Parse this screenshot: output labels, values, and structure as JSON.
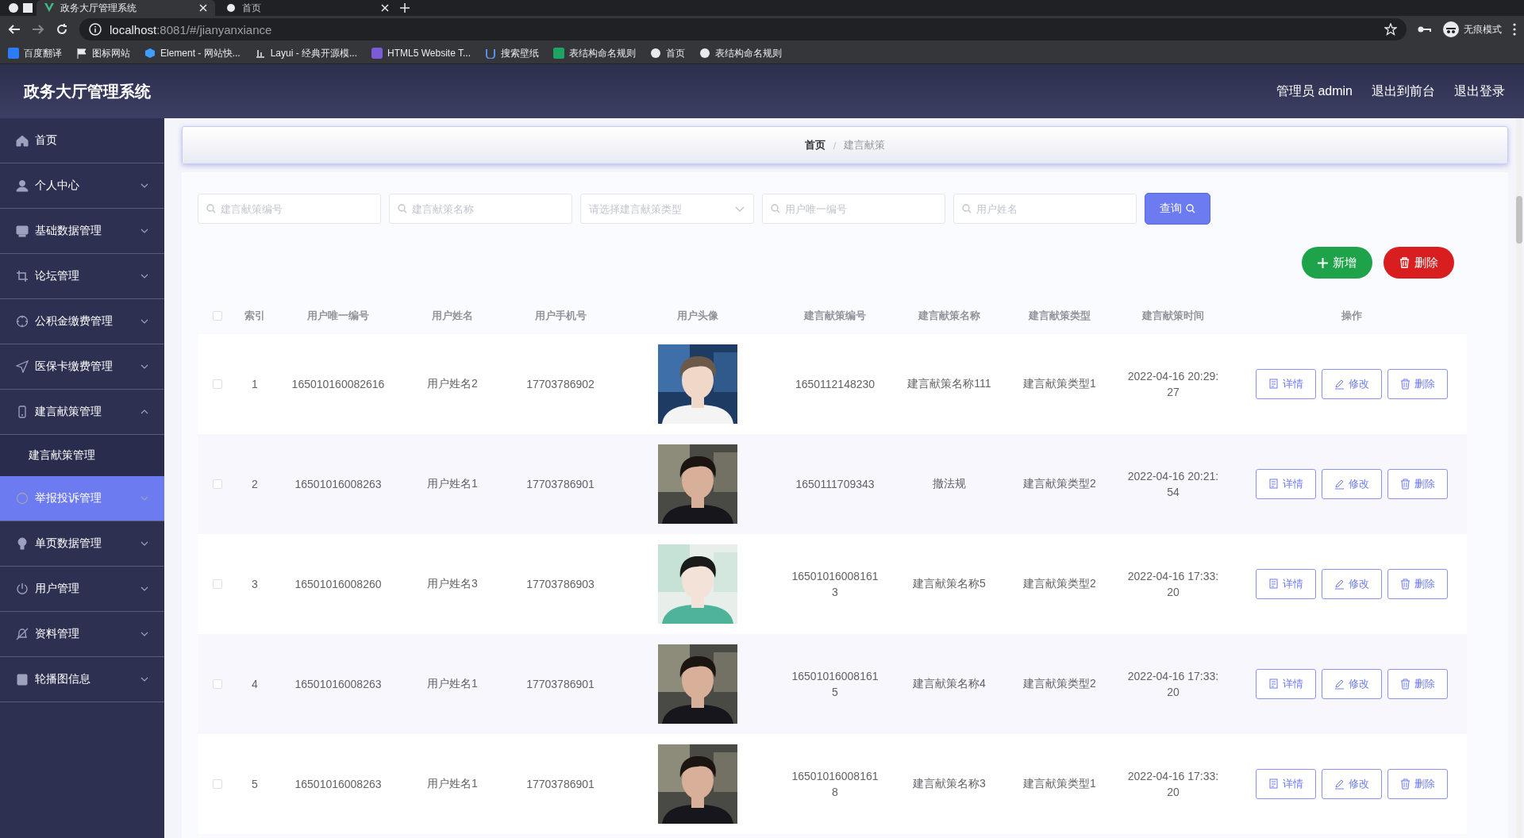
{
  "browser": {
    "tabs": [
      {
        "title": "政务大厅管理系统",
        "selected": true
      },
      {
        "title": "首页",
        "selected": false
      }
    ],
    "url": {
      "host": "localhost",
      "path": ":8081/#/jianyanxiance"
    },
    "profile": "无痕模式",
    "bookmarks": [
      "百度翻译",
      "图标网站",
      "Element - 网站快...",
      "Layui - 经典开源模...",
      "HTML5 Website T...",
      "搜索壁纸",
      "表结构命名规则",
      "首页",
      "表结构命名规则"
    ]
  },
  "header": {
    "title": "政务大厅管理系统",
    "links": [
      "管理员 admin",
      "退出到前台",
      "退出登录"
    ]
  },
  "sidebar": {
    "items": [
      {
        "label": "首页",
        "expandable": false,
        "expanded": false,
        "selected": false
      },
      {
        "label": "个人中心",
        "expandable": true,
        "expanded": false,
        "selected": false
      },
      {
        "label": "基础数据管理",
        "expandable": true,
        "expanded": false,
        "selected": false
      },
      {
        "label": "论坛管理",
        "expandable": true,
        "expanded": false,
        "selected": false
      },
      {
        "label": "公积金缴费管理",
        "expandable": true,
        "expanded": false,
        "selected": false
      },
      {
        "label": "医保卡缴费管理",
        "expandable": true,
        "expanded": false,
        "selected": false
      },
      {
        "label": "建言献策管理",
        "expandable": true,
        "expanded": true,
        "selected": false,
        "children": [
          {
            "label": "建言献策管理",
            "selected": false
          }
        ]
      },
      {
        "label": "举报投诉管理",
        "expandable": true,
        "expanded": false,
        "selected": true
      },
      {
        "label": "单页数据管理",
        "expandable": true,
        "expanded": false,
        "selected": false
      },
      {
        "label": "用户管理",
        "expandable": true,
        "expanded": false,
        "selected": false
      },
      {
        "label": "资料管理",
        "expandable": true,
        "expanded": false,
        "selected": false
      },
      {
        "label": "轮播图信息",
        "expandable": true,
        "expanded": false,
        "selected": false
      }
    ]
  },
  "breadcrumb": {
    "items": [
      "首页",
      "建言献策"
    ],
    "separator": "/"
  },
  "filters": [
    {
      "kind": "search",
      "placeholder": "建言献策编号"
    },
    {
      "kind": "search",
      "placeholder": "建言献策名称"
    },
    {
      "kind": "select",
      "placeholder": "请选择建言献策类型"
    },
    {
      "kind": "search",
      "placeholder": "用户唯一编号"
    },
    {
      "kind": "search",
      "placeholder": "用户姓名"
    }
  ],
  "search_button": "查询",
  "actions": [
    {
      "kind": "add",
      "label": "新增"
    },
    {
      "kind": "delete",
      "label": "删除"
    }
  ],
  "table": {
    "select_all": {
      "checked": false
    },
    "columns": [
      "索引",
      "用户唯一编号",
      "用户姓名",
      "用户手机号",
      "用户头像",
      "建言献策编号",
      "建言献策名称",
      "建言献策类型",
      "建言献策时间",
      "操作"
    ],
    "rows": [
      {
        "checked": false,
        "index": "1",
        "user_no": "165010160082616",
        "user_name": "用户姓名2",
        "phone": "17703786902",
        "advice_no": "1650112148230",
        "advice_name": "建言献策名称111",
        "advice_type": "建言献策类型1",
        "time": "2022-04-16 20:29:27",
        "buttons": [
          "详情",
          "修改",
          "删除"
        ]
      },
      {
        "checked": false,
        "index": "2",
        "user_no": "16501016008263",
        "user_name": "用户姓名1",
        "phone": "17703786901",
        "advice_no": "1650111709343",
        "advice_name": "撤法规",
        "advice_type": "建言献策类型2",
        "time": "2022-04-16 20:21:54",
        "buttons": [
          "详情",
          "修改",
          "删除"
        ]
      },
      {
        "checked": false,
        "index": "3",
        "user_no": "16501016008260",
        "user_name": "用户姓名3",
        "phone": "17703786903",
        "advice_no": "165010160081613",
        "advice_name": "建言献策名称5",
        "advice_type": "建言献策类型2",
        "time": "2022-04-16 17:33:20",
        "buttons": [
          "详情",
          "修改",
          "删除"
        ]
      },
      {
        "checked": false,
        "index": "4",
        "user_no": "16501016008263",
        "user_name": "用户姓名1",
        "phone": "17703786901",
        "advice_no": "165010160081615",
        "advice_name": "建言献策名称4",
        "advice_type": "建言献策类型2",
        "time": "2022-04-16 17:33:20",
        "buttons": [
          "详情",
          "修改",
          "删除"
        ]
      },
      {
        "checked": false,
        "index": "5",
        "user_no": "16501016008263",
        "user_name": "用户姓名1",
        "phone": "17703786901",
        "advice_no": "165010160081618",
        "advice_name": "建言献策名称3",
        "advice_type": "建言献策类型1",
        "time": "2022-04-16 17:33:20",
        "buttons": [
          "详情",
          "修改",
          "删除"
        ]
      }
    ]
  }
}
